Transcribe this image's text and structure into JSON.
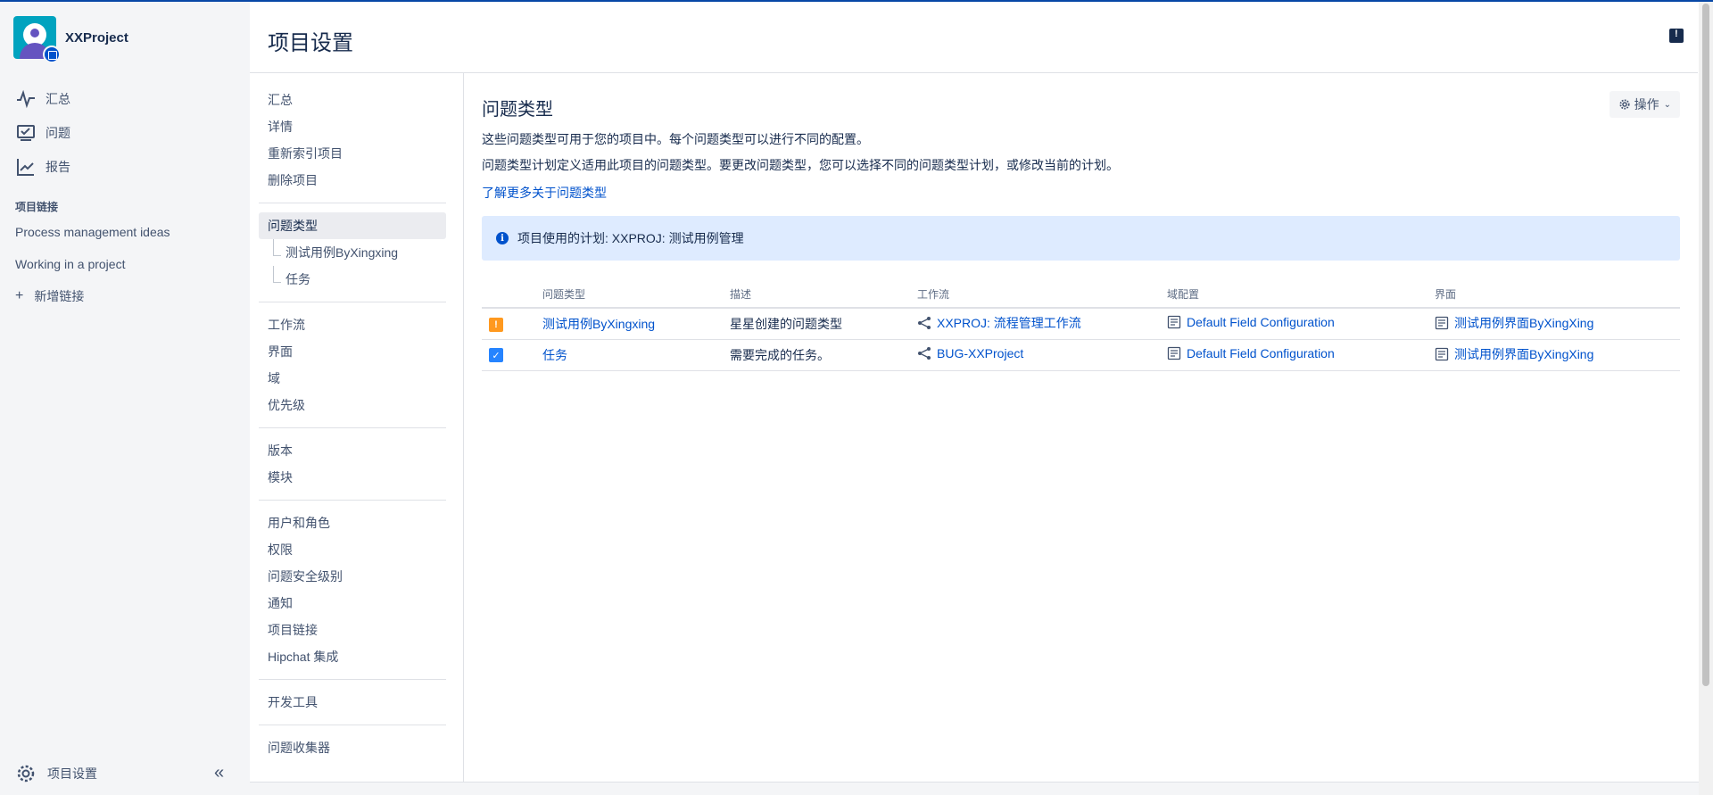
{
  "project": {
    "name": "XXProject"
  },
  "nav": {
    "items": [
      {
        "label": "汇总",
        "icon": "pulse-icon"
      },
      {
        "label": "问题",
        "icon": "issues-icon"
      },
      {
        "label": "报告",
        "icon": "reports-icon"
      }
    ]
  },
  "project_links": {
    "title": "项目链接",
    "items": [
      "Process management ideas",
      "Working in a project"
    ],
    "add_label": "新增链接"
  },
  "footer": {
    "settings_label": "项目设置"
  },
  "page": {
    "title": "项目设置"
  },
  "settings_nav": {
    "group1": [
      "汇总",
      "详情",
      "重新索引项目",
      "删除项目"
    ],
    "active": "问题类型",
    "subs": [
      "测试用例ByXingxing",
      "任务"
    ],
    "group2": [
      "工作流",
      "界面",
      "域",
      "优先级"
    ],
    "group3": [
      "版本",
      "模块"
    ],
    "group4": [
      "用户和角色",
      "权限",
      "问题安全级别",
      "通知",
      "项目链接",
      "Hipchat 集成"
    ],
    "group5": [
      "开发工具"
    ],
    "group6": [
      "问题收集器"
    ]
  },
  "content": {
    "heading": "问题类型",
    "actions_label": "操作",
    "desc1": "这些问题类型可用于您的项目中。每个问题类型可以进行不同的配置。",
    "desc2": "问题类型计划定义适用此项目的问题类型。要更改问题类型，您可以选择不同的问题类型计划，或修改当前的计划。",
    "learn_more": "了解更多关于问题类型",
    "info": "项目使用的计划: XXPROJ: 测试用例管理"
  },
  "table": {
    "headers": [
      "问题类型",
      "描述",
      "工作流",
      "域配置",
      "界面"
    ],
    "rows": [
      {
        "icon": "warning-icon",
        "type": "测试用例ByXingxing",
        "desc": "星星创建的问题类型",
        "workflow": "XXPROJ: 流程管理工作流",
        "field": "Default Field Configuration",
        "screen": "测试用例界面ByXingXing"
      },
      {
        "icon": "task-icon",
        "type": "任务",
        "desc": "需要完成的任务。",
        "workflow": "BUG-XXProject",
        "field": "Default Field Configuration",
        "screen": "测试用例界面ByXingXing"
      }
    ]
  }
}
